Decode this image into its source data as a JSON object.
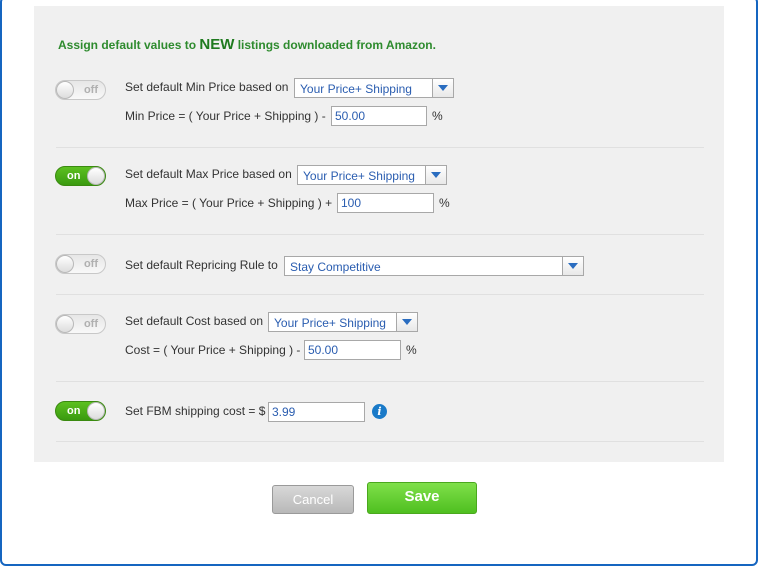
{
  "heading": {
    "prefix": "Assign default values to ",
    "emphasis": "NEW",
    "suffix": " listings downloaded from Amazon."
  },
  "settings": [
    {
      "toggle": "off",
      "label": "Set default Min Price based on",
      "select": "Your Price+ Shipping",
      "formula": "Min Price = ( Your Price + Shipping ) -",
      "value": "50.00",
      "unit": "%"
    },
    {
      "toggle": "on",
      "label": "Set default Max Price based on",
      "select": "Your Price+ Shipping",
      "formula": "Max Price = ( Your Price + Shipping ) +",
      "value": "100",
      "unit": "%"
    },
    {
      "toggle": "off",
      "label": "Set default Repricing Rule to",
      "select": "Stay Competitive"
    },
    {
      "toggle": "off",
      "label": "Set default Cost based on",
      "select": "Your Price+ Shipping",
      "formula": "Cost = ( Your Price + Shipping ) -",
      "value": "50.00",
      "unit": "%"
    },
    {
      "toggle": "on",
      "label": "Set FBM shipping cost = $",
      "value": "3.99",
      "info_icon": "info-icon"
    }
  ],
  "buttons": {
    "cancel": "Cancel",
    "save": "Save"
  },
  "colors": {
    "accent_green": "#4fbf20",
    "frame_blue": "#1565c0",
    "link_blue": "#2a5db0"
  }
}
